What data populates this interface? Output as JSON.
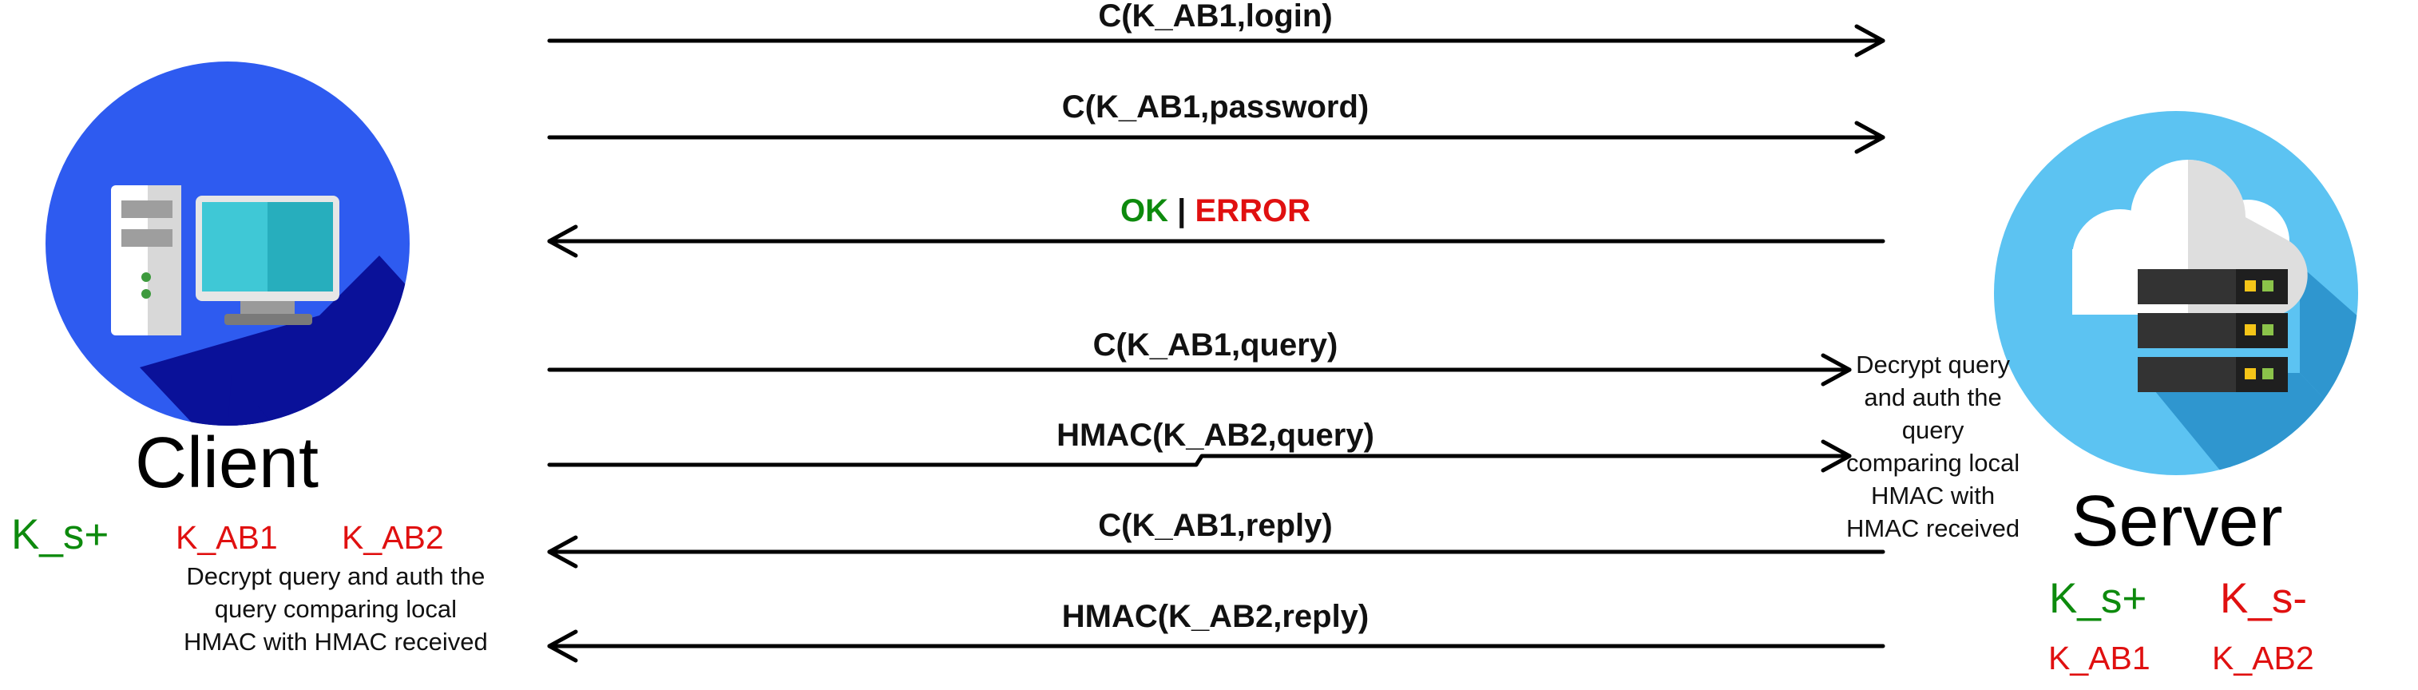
{
  "client": {
    "label": "Client",
    "public_key": "K_s+",
    "keys": [
      "K_AB1",
      "K_AB2"
    ],
    "note_lines": [
      "Decrypt query and auth the",
      "query comparing local",
      "HMAC with HMAC received"
    ]
  },
  "server": {
    "label": "Server",
    "public_key": "K_s+",
    "private_key": "K_s-",
    "keys": [
      "K_AB1",
      "K_AB2"
    ],
    "note_lines": [
      "Decrypt query",
      "and auth the",
      "query",
      "comparing local",
      "HMAC with",
      "HMAC received"
    ]
  },
  "messages": [
    {
      "label": "C(K_AB1,login)",
      "direction": "to-server"
    },
    {
      "label": "C(K_AB1,password)",
      "direction": "to-server"
    },
    {
      "ok": "OK",
      "sep": "|",
      "error": "ERROR",
      "direction": "to-client"
    },
    {
      "label": "C(K_AB1,query)",
      "direction": "to-server"
    },
    {
      "label": "HMAC(K_AB2,query)",
      "direction": "to-server"
    },
    {
      "label": "C(K_AB1,reply)",
      "direction": "to-client"
    },
    {
      "label": "HMAC(K_AB2,reply)",
      "direction": "to-client"
    }
  ],
  "colors": {
    "ok": "#0d8a0d",
    "error": "#e01010",
    "client_circle": "#2e5bf0",
    "server_circle": "#5cc3f2"
  }
}
